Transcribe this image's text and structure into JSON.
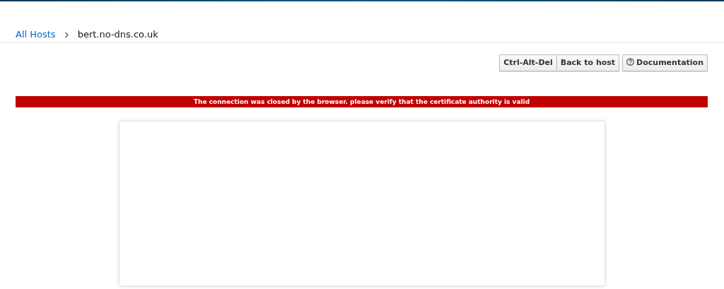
{
  "breadcrumb": [
    {
      "label": "All Hosts",
      "kind": "link"
    },
    {
      "label": "bert.no-dns.co.uk",
      "kind": "current"
    }
  ],
  "button_groups": [
    {
      "buttons": [
        {
          "label": "Ctrl-Alt-Del",
          "kind": "plain"
        },
        {
          "label": "Back to host",
          "kind": "plain"
        }
      ]
    },
    {
      "buttons": [
        {
          "label": "Documentation",
          "kind": "help"
        }
      ]
    }
  ],
  "alert": {
    "text": "The connection was closed by the browser. please verify that the certificate authority is valid"
  }
}
